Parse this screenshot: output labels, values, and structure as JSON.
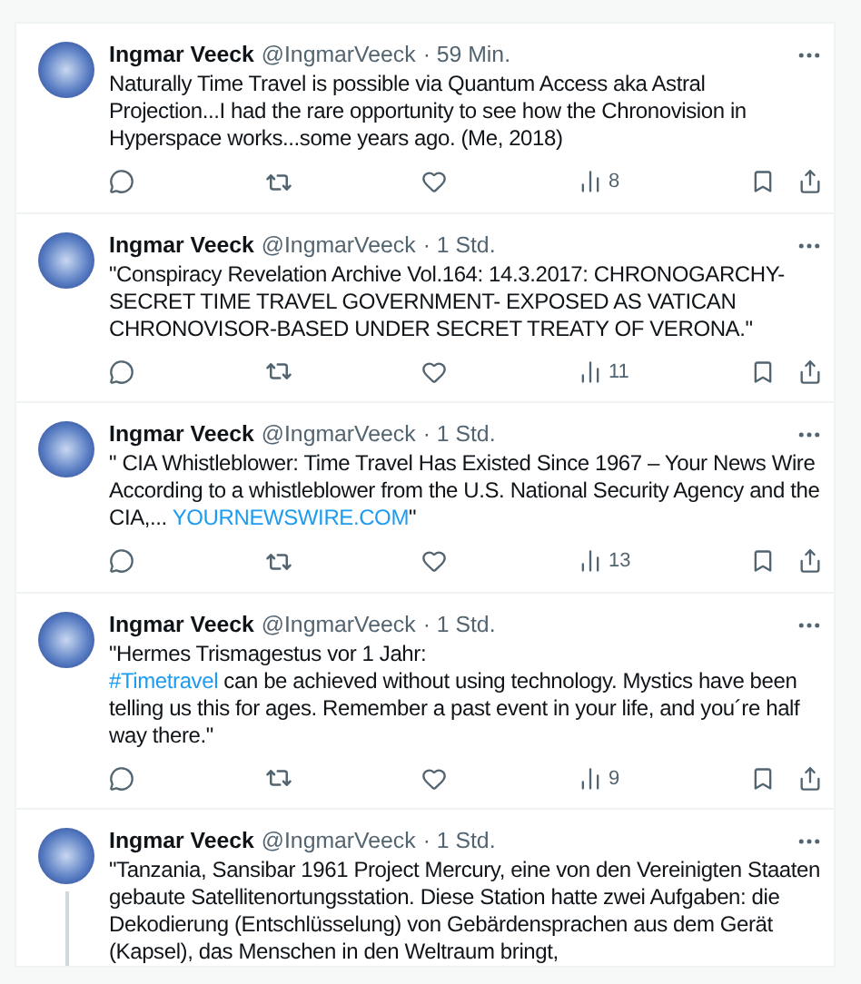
{
  "tweets": [
    {
      "name": "Ingmar Veeck",
      "handle": "@IngmarVeeck",
      "time": "· 59 Min.",
      "parts": [
        {
          "kind": "text",
          "text": "Naturally Time Travel is possible via Quantum Access aka Astral Projection...I had the rare opportunity to see how the Chronovision in Hyperspace works...some years ago. (Me, 2018)"
        }
      ],
      "views": "8",
      "thread": false
    },
    {
      "name": "Ingmar Veeck",
      "handle": "@IngmarVeeck",
      "time": "· 1 Std.",
      "parts": [
        {
          "kind": "text",
          "text": "\"Conspiracy Revelation Archive Vol.164: 14.3.2017: CHRONOGARCHY-SECRET TIME TRAVEL GOVERNMENT- EXPOSED AS VATICAN CHRONOVISOR-BASED UNDER SECRET TREATY OF VERONA.\""
        }
      ],
      "views": "11",
      "thread": false
    },
    {
      "name": "Ingmar Veeck",
      "handle": "@IngmarVeeck",
      "time": "· 1 Std.",
      "parts": [
        {
          "kind": "text",
          "text": "\" CIA Whistleblower: Time Travel Has Existed Since 1967 – Your News Wire According to a whistleblower from the U.S. National Security Agency and the CIA,... "
        },
        {
          "kind": "link",
          "text": "YOURNEWSWIRE.COM"
        },
        {
          "kind": "text",
          "text": "\""
        }
      ],
      "views": "13",
      "thread": false
    },
    {
      "name": "Ingmar Veeck",
      "handle": "@IngmarVeeck",
      "time": "· 1 Std.",
      "parts": [
        {
          "kind": "text",
          "text": "\"Hermes Trismagestus vor 1 Jahr:\n"
        },
        {
          "kind": "link",
          "text": "#Timetravel"
        },
        {
          "kind": "text",
          "text": " can be achieved without using technology. Mystics have been telling us this for ages. Remember a past event in your life, and you´re half way there.\""
        }
      ],
      "views": "9",
      "thread": false
    },
    {
      "name": "Ingmar Veeck",
      "handle": "@IngmarVeeck",
      "time": "· 1 Std.",
      "parts": [
        {
          "kind": "text",
          "text": "\"Tanzania, Sansibar 1961 Project Mercury, eine von den Vereinigten Staaten gebaute Satellitenortungsstation. Diese Station hatte zwei Aufgaben: die Dekodierung (Entschlüsselung) von Gebärdensprachen aus dem Gerät (Kapsel), das Menschen in den Weltraum bringt,"
        }
      ],
      "thread": true
    }
  ]
}
